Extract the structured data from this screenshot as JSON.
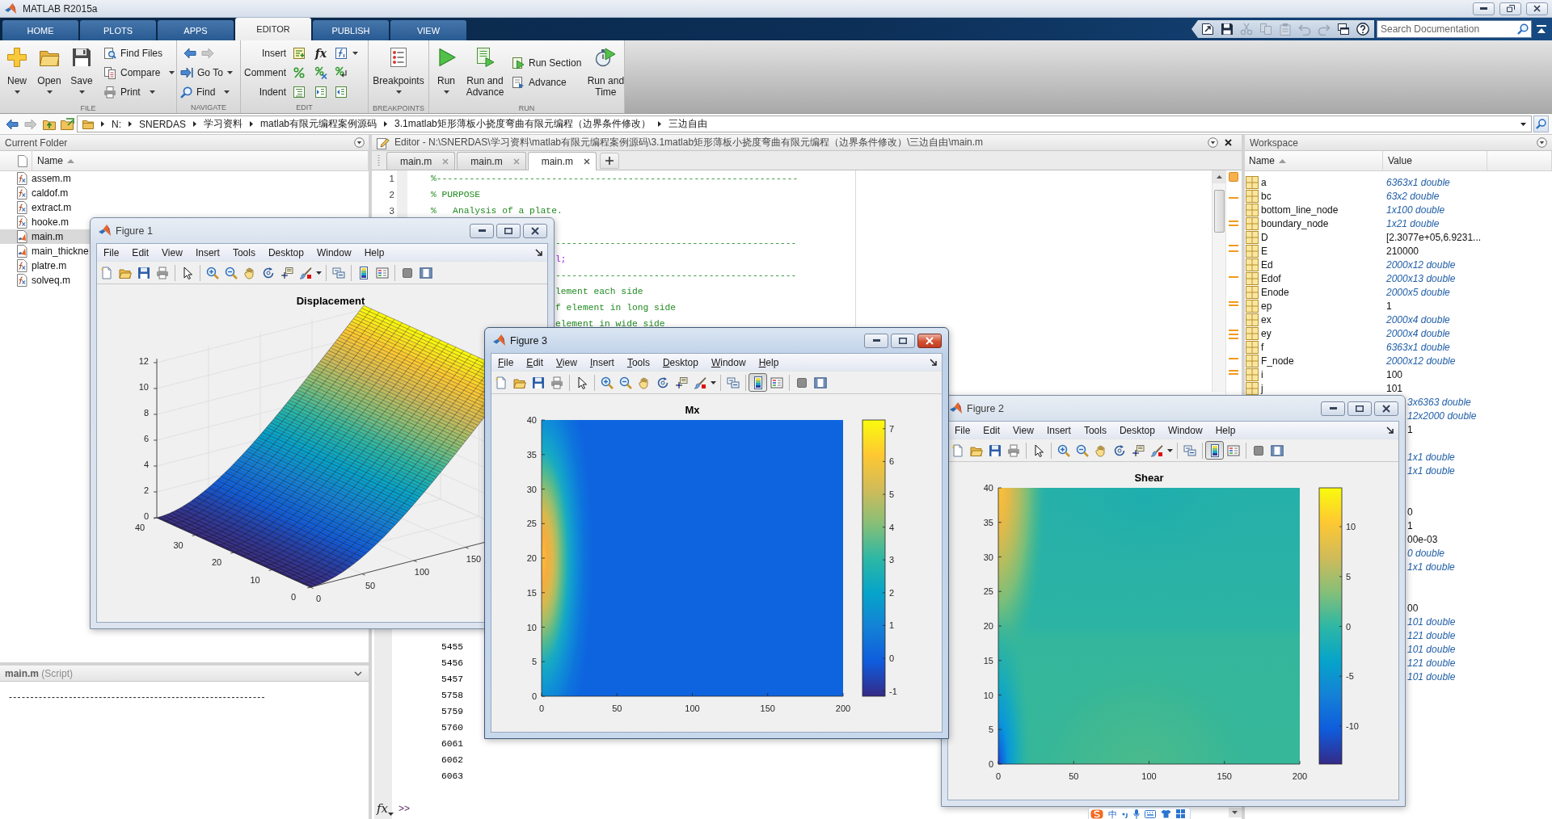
{
  "window": {
    "title": "MATLAB R2015a"
  },
  "ribbon_tabs": [
    {
      "label": "HOME",
      "selected": false
    },
    {
      "label": "PLOTS",
      "selected": false
    },
    {
      "label": "APPS",
      "selected": false
    },
    {
      "label": "EDITOR",
      "selected": true
    },
    {
      "label": "PUBLISH",
      "selected": false
    },
    {
      "label": "VIEW",
      "selected": false
    }
  ],
  "quick_access": [
    {
      "disabled": false
    },
    {
      "disabled": false
    },
    {
      "disabled": true
    },
    {
      "disabled": true
    },
    {
      "disabled": true
    },
    {
      "disabled": true
    },
    {
      "disabled": true
    },
    {
      "disabled": false
    },
    {
      "disabled": false
    }
  ],
  "search": {
    "placeholder": "Search Documentation"
  },
  "toolstrip": {
    "file": {
      "label": "FILE",
      "new": "New",
      "open": "Open",
      "save": "Save",
      "find_files": "Find Files",
      "compare": "Compare",
      "print": "Print"
    },
    "navigate": {
      "label": "NAVIGATE",
      "back_disabled": false,
      "forward_disabled": true,
      "go_to": "Go To",
      "find": "Find"
    },
    "edit": {
      "label": "EDIT",
      "insert": "Insert",
      "comment": "Comment",
      "indent": "Indent",
      "function_symbol": "fx"
    },
    "breakpoints": {
      "label": "BREAKPOINTS",
      "breakpoints": "Breakpoints"
    },
    "run": {
      "label": "RUN",
      "run": "Run",
      "run_and_advance": "Run and Advance",
      "run_section": "Run Section",
      "advance": "Advance",
      "run_and_time": "Run and Time"
    }
  },
  "address_bar": {
    "back_disabled": false,
    "forward_disabled": true,
    "path": [
      "N:",
      "SNERDAS",
      "学习资料",
      "matlab有限元编程案例源码",
      "3.1matlab矩形薄板小挠度弯曲有限元编程（边界条件修改）",
      "三边自由"
    ]
  },
  "current_folder": {
    "title": "Current Folder",
    "column": "Name",
    "files": [
      {
        "name": "assem.m",
        "kind": "function",
        "selected": false
      },
      {
        "name": "caldof.m",
        "kind": "function",
        "selected": false
      },
      {
        "name": "extract.m",
        "kind": "function",
        "selected": false
      },
      {
        "name": "hooke.m",
        "kind": "function",
        "selected": false
      },
      {
        "name": "main.m",
        "kind": "script",
        "selected": true
      },
      {
        "name": "main_thickne",
        "kind": "script",
        "selected": false
      },
      {
        "name": "platre.m",
        "kind": "function",
        "selected": false
      },
      {
        "name": "solveq.m",
        "kind": "function",
        "selected": false
      }
    ],
    "details": {
      "title": "**main.m** (Script)",
      "preview": "------------------------------------------------------------"
    }
  },
  "editor": {
    "title": "Editor - N:\\SNERDAS\\学习资料\\matlab有限元编程案例源码\\3.1matlab矩形薄板小挠度弯曲有限元编程（边界条件修改）\\三边自由\\main.m",
    "tabs": [
      {
        "label": "main.m",
        "selected": false
      },
      {
        "label": "main.m",
        "selected": false
      },
      {
        "label": "main.m",
        "selected": true
      }
    ],
    "lines": [
      {
        "kind": "full",
        "number": "1",
        "text": "%------------------------------------------------------------------",
        "comment": true,
        "string": false
      },
      {
        "kind": "full",
        "number": "2",
        "text": "% PURPOSE",
        "comment": true,
        "string": false
      },
      {
        "kind": "full",
        "number": "3",
        "text": "%   Analysis of a plate.",
        "comment": true,
        "string": false
      },
      {
        "kind": "covered"
      },
      {
        "kind": "tail",
        "text": "--------------------------------------------",
        "comment": true,
        "string": false
      },
      {
        "kind": "tail",
        "text": "l;",
        "comment": false,
        "string": true
      },
      {
        "kind": "tail",
        "text": "--------------------------------------------",
        "comment": true,
        "string": false
      },
      {
        "kind": "tail",
        "text": "lement each side",
        "comment": true,
        "string": false
      },
      {
        "kind": "tail",
        "text": "f element in long side",
        "comment": true,
        "string": false
      },
      {
        "kind": "tail",
        "text": "element in wide side",
        "comment": true,
        "string": false
      }
    ]
  },
  "command_window": {
    "output": [
      "5455",
      "5456",
      "5457",
      "5758",
      "5759",
      "5760",
      "6061",
      "6062",
      "6063"
    ],
    "function_button": "fx",
    "prompt": ">>"
  },
  "workspace": {
    "title": "Workspace",
    "columns": [
      "Name",
      "Value"
    ],
    "variables": [
      {
        "name": "a",
        "value": "6363x1 double",
        "summary": true
      },
      {
        "name": "bc",
        "value": "63x2 double",
        "summary": true
      },
      {
        "name": "bottom_line_node",
        "value": "1x100 double",
        "summary": true
      },
      {
        "name": "boundary_node",
        "value": "1x21 double",
        "summary": true
      },
      {
        "name": "D",
        "value": "[2.3077e+05,6.9231...",
        "summary": false
      },
      {
        "name": "E",
        "value": "210000",
        "summary": false
      },
      {
        "name": "Ed",
        "value": "2000x12 double",
        "summary": true
      },
      {
        "name": "Edof",
        "value": "2000x13 double",
        "summary": true
      },
      {
        "name": "Enode",
        "value": "2000x5 double",
        "summary": true
      },
      {
        "name": "ep",
        "value": "1",
        "summary": false
      },
      {
        "name": "ex",
        "value": "2000x4 double",
        "summary": true
      },
      {
        "name": "ey",
        "value": "2000x4 double",
        "summary": true
      },
      {
        "name": "f",
        "value": "6363x1 double",
        "summary": true
      },
      {
        "name": "F_node",
        "value": "2000x12 double",
        "summary": true
      },
      {
        "name": "i",
        "value": "100",
        "summary": false
      },
      {
        "name": "j",
        "value": "101",
        "summary": false
      }
    ],
    "covered_variables": [
      {
        "kind": "value",
        "value": "3x6363 double",
        "summary": true
      },
      {
        "kind": "value",
        "value": "12x2000 double",
        "summary": true
      },
      {
        "kind": "value",
        "value": "1",
        "summary": false
      },
      {
        "kind": "blank"
      },
      {
        "kind": "value",
        "value": "1x1 double",
        "summary": true
      },
      {
        "kind": "value",
        "value": "1x1 double",
        "summary": true
      },
      {
        "kind": "blank"
      },
      {
        "kind": "blank"
      },
      {
        "kind": "value",
        "value": "0",
        "summary": false
      },
      {
        "kind": "value",
        "value": "1",
        "summary": false
      },
      {
        "kind": "value",
        "value": "00e-03",
        "summary": false
      },
      {
        "kind": "value",
        "value": "0 double",
        "summary": true
      },
      {
        "kind": "value",
        "value": "1x1 double",
        "summary": true
      },
      {
        "kind": "blank"
      },
      {
        "kind": "blank"
      },
      {
        "kind": "value",
        "value": "00",
        "summary": false
      },
      {
        "kind": "value",
        "value": "101 double",
        "summary": true
      },
      {
        "kind": "value",
        "value": "121 double",
        "summary": true
      },
      {
        "kind": "value",
        "value": "101 double",
        "summary": true
      },
      {
        "kind": "value",
        "value": "121 double",
        "summary": true
      },
      {
        "kind": "value",
        "value": "101 double",
        "summary": true
      }
    ]
  },
  "figures": [
    {
      "title": "Figure 1",
      "active": false,
      "menus": [
        "File",
        "Edit",
        "View",
        "Insert",
        "Tools",
        "Desktop",
        "Window",
        "Help"
      ],
      "colorbar_pressed": false,
      "plot": {
        "kind": "surface",
        "title": "Displacement",
        "z_ticks": [
          "12",
          "10",
          "8",
          "6",
          "4",
          "2",
          "0"
        ],
        "y_ticks": [
          "40",
          "30",
          "20",
          "10",
          "0"
        ],
        "x_ticks": [
          "0",
          "50",
          "100",
          "150"
        ]
      }
    },
    {
      "title": "Figure 3",
      "active": true,
      "menus": [
        "File",
        "Edit",
        "View",
        "Insert",
        "Tools",
        "Desktop",
        "Window",
        "Help"
      ],
      "colorbar_pressed": true,
      "plot": {
        "kind": "moment",
        "title": "Mx",
        "y_ticks": [
          "40",
          "35",
          "30",
          "25",
          "20",
          "15",
          "10",
          "5",
          "0"
        ],
        "x_ticks": [
          "0",
          "50",
          "100",
          "150",
          "200"
        ],
        "colorbar_ticks": [
          "7",
          "6",
          "5",
          "4",
          "3",
          "2",
          "1",
          "0",
          "-1"
        ]
      }
    },
    {
      "title": "Figure 2",
      "active": false,
      "menus": [
        "File",
        "Edit",
        "View",
        "Insert",
        "Tools",
        "Desktop",
        "Window",
        "Help"
      ],
      "colorbar_pressed": true,
      "plot": {
        "kind": "shear",
        "title": "Shear",
        "y_ticks": [
          "40",
          "35",
          "30",
          "25",
          "20",
          "15",
          "10",
          "5",
          "0"
        ],
        "x_ticks": [
          "0",
          "50",
          "100",
          "150",
          "200"
        ],
        "colorbar_ticks": [
          "10",
          "5",
          "0",
          "-5",
          "-10"
        ]
      }
    }
  ],
  "input_method_bar": {
    "mode": "中"
  }
}
